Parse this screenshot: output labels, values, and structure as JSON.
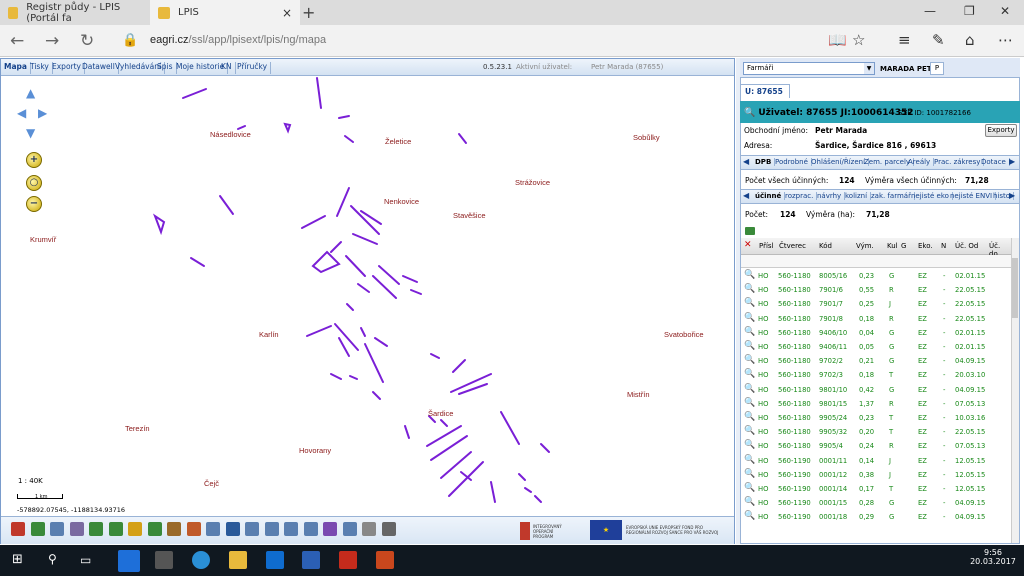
{
  "browser": {
    "tabs": [
      {
        "title": "Registr půdy - LPIS (Portál fa",
        "icon": "leaf-icon"
      },
      {
        "title": "LPIS",
        "icon": "leaf-icon"
      }
    ],
    "close_glyph": "×",
    "new_tab_glyph": "+",
    "url_host": "eagri.cz",
    "url_path": "/ssl/app/lpisext/lpis/ng/mapa",
    "window_controls": [
      "—",
      "❐",
      "✕"
    ]
  },
  "map_app": {
    "menu": [
      "Mapa",
      "Tisky",
      "Exporty",
      "Datawell",
      "Vyhledávání",
      "Spis",
      "Moje historie",
      "KN",
      "Příručky"
    ],
    "version": "0.5.23.1",
    "active_user_label": "Aktivní uživatel:",
    "active_user": "Petr Marada (87655)",
    "villages": [
      "Násedlovice",
      "Želetice",
      "Sobůlky",
      "Strážovice",
      "Nenkovice",
      "Stavěšice",
      "Krumvíř",
      "Karlín",
      "Svatobořice",
      "Mistřín",
      "Šardice",
      "Terezín",
      "Hovorany",
      "Čejč"
    ],
    "scale": "1 : 40K",
    "scale_unit": "1 km",
    "coords": "-578892.07545, -1188134.93716",
    "logo1": "INTEGROVANÝ OPERAČNÍ PROGRAM",
    "logo2": "EVROPSKÁ UNIE EVROPSKÝ FOND PRO REGIONÁLNÍ ROZVOJ ŠANCE PRO VÁŠ ROZVOJ",
    "parcel_color": "#7a1fd6"
  },
  "panel": {
    "farm_select": "Farmáři",
    "farmer": "MARADA PETR",
    "p_btn": "P",
    "user_tab": "U: 87655",
    "header": "Uživatel: 87655 JI:1000614352",
    "szr": "SZR ID: 1001782166",
    "business_label": "Obchodní jméno:",
    "business_value": "Petr Marada",
    "address_label": "Adresa:",
    "address_value": "Šardice, Šardice 816 , 69613",
    "export": "Exporty",
    "tabs1": [
      "DPB",
      "Podrobné",
      "Ohlášení/Řízení",
      "Zem. parcely",
      "Areály",
      "Prac. zákresy",
      "Dotace"
    ],
    "count_label": "Počet všech účinných:",
    "count_value": "124",
    "area_label": "Výměra všech účinných:",
    "area_value": "71,28",
    "tabs2": [
      "účinné",
      "rozprac.",
      "návrhy",
      "kolizní",
      "zak. farmář",
      "nejisté eko",
      "nejisté ENVI",
      "histo"
    ],
    "count2_label": "Počet:",
    "count2_value": "124",
    "area2_label": "Výměra (ha):",
    "area2_value": "71,28",
    "columns": [
      "Přísl",
      "Čtverec",
      "Kód",
      "Vým.",
      "Kul",
      "G",
      "Eko.",
      "N",
      "Úč. Od",
      "Úč. do"
    ],
    "rows": [
      [
        "HO",
        "560-1180",
        "8005/16",
        "0,23",
        "G",
        "EZ",
        "-",
        "02.01.15"
      ],
      [
        "HO",
        "560-1180",
        "7901/6",
        "0,55",
        "R",
        "EZ",
        "-",
        "22.05.15"
      ],
      [
        "HO",
        "560-1180",
        "7901/7",
        "0,25",
        "J",
        "EZ",
        "-",
        "22.05.15"
      ],
      [
        "HO",
        "560-1180",
        "7901/8",
        "0,18",
        "R",
        "EZ",
        "-",
        "22.05.15"
      ],
      [
        "HO",
        "560-1180",
        "9406/10",
        "0,04",
        "G",
        "EZ",
        "-",
        "02.01.15"
      ],
      [
        "HO",
        "560-1180",
        "9406/11",
        "0,05",
        "G",
        "EZ",
        "-",
        "02.01.15"
      ],
      [
        "HO",
        "560-1180",
        "9702/2",
        "0,21",
        "G",
        "EZ",
        "-",
        "04.09.15"
      ],
      [
        "HO",
        "560-1180",
        "9702/3",
        "0,18",
        "T",
        "EZ",
        "-",
        "20.03.10"
      ],
      [
        "HO",
        "560-1180",
        "9801/10",
        "0,42",
        "G",
        "EZ",
        "-",
        "04.09.15"
      ],
      [
        "HO",
        "560-1180",
        "9801/15",
        "1,37",
        "R",
        "EZ",
        "-",
        "07.05.13"
      ],
      [
        "HO",
        "560-1180",
        "9905/24",
        "0,23",
        "T",
        "EZ",
        "-",
        "10.03.16"
      ],
      [
        "HO",
        "560-1180",
        "9905/32",
        "0,20",
        "T",
        "EZ",
        "-",
        "22.05.15"
      ],
      [
        "HO",
        "560-1180",
        "9905/4",
        "0,24",
        "R",
        "EZ",
        "-",
        "07.05.13"
      ],
      [
        "HO",
        "560-1190",
        "0001/11",
        "0,14",
        "J",
        "EZ",
        "-",
        "12.05.15"
      ],
      [
        "HO",
        "560-1190",
        "0001/12",
        "0,38",
        "J",
        "EZ",
        "-",
        "12.05.15"
      ],
      [
        "HO",
        "560-1190",
        "0001/14",
        "0,17",
        "T",
        "EZ",
        "-",
        "12.05.15"
      ],
      [
        "HO",
        "560-1190",
        "0001/15",
        "0,28",
        "G",
        "EZ",
        "-",
        "04.09.15"
      ],
      [
        "HO",
        "560-1190",
        "0001/18",
        "0,29",
        "G",
        "EZ",
        "-",
        "04.09.15"
      ]
    ]
  },
  "taskbar": {
    "time": "9:56",
    "date": "20.03.2017"
  }
}
